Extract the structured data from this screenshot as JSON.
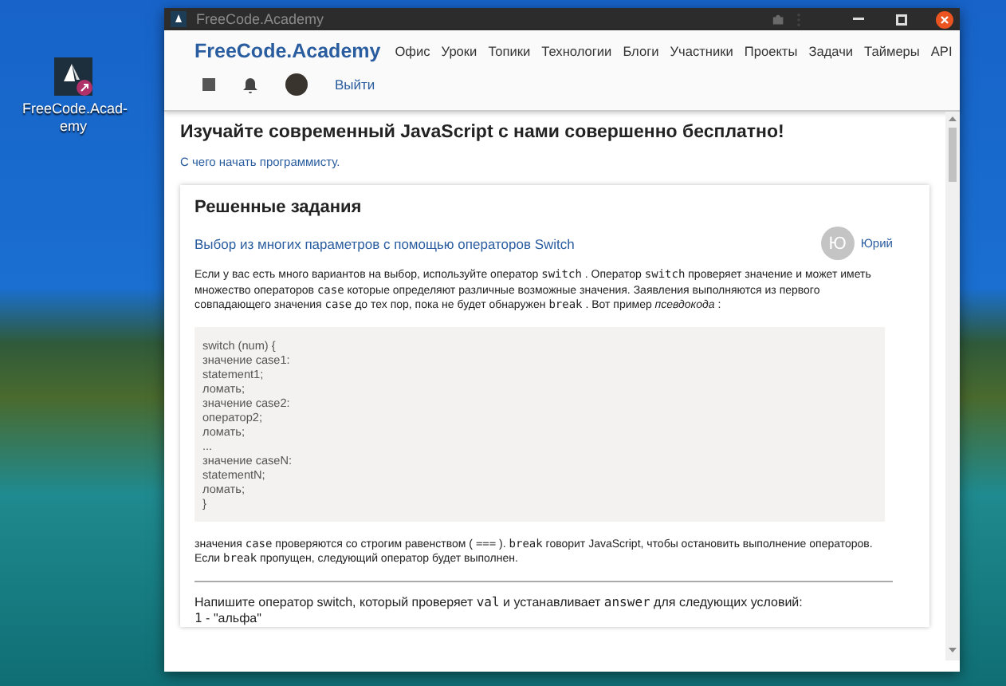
{
  "desktop_icon": {
    "label": "FreeCode.Acad-emy"
  },
  "window": {
    "title": "FreeCode.Academy"
  },
  "nav": {
    "brand": "FreeCode.Academy",
    "items": [
      "Офис",
      "Уроки",
      "Топики",
      "Технологии",
      "Блоги",
      "Участники",
      "Проекты",
      "Задачи",
      "Таймеры",
      "API"
    ],
    "logout": "Выйти"
  },
  "content": {
    "headline": "Изучайте современный JavaScript с нами совершенно бесплатно!",
    "link": "С чего начать программисту.",
    "card": {
      "title": "Решенные задания",
      "task": {
        "title": "Выбор из многих параметров с помощью операторов Switch",
        "author_initial": "Ю",
        "author": "Юрий"
      },
      "intro": [
        {
          "kind": "text",
          "text": "Если у вас есть много вариантов на выбор, используйте оператор "
        },
        {
          "kind": "code",
          "text": "switch"
        },
        {
          "kind": "text",
          "text": " . Оператор "
        },
        {
          "kind": "code",
          "text": "switch"
        },
        {
          "kind": "text",
          "text": " проверяет значение и может иметь множество операторов "
        },
        {
          "kind": "code",
          "text": "case"
        },
        {
          "kind": "text",
          "text": " которые определяют различные возможные значения. Заявления выполняются из первого совпадающего значения "
        },
        {
          "kind": "code",
          "text": "case"
        },
        {
          "kind": "text",
          "text": " до тех пор, пока не будет обнаружен "
        },
        {
          "kind": "code",
          "text": "break"
        },
        {
          "kind": "text",
          "text": " . Вот пример "
        },
        {
          "kind": "em",
          "text": "псевдокода"
        },
        {
          "kind": "text",
          "text": " :"
        }
      ],
      "code_lines": [
        "switch (num) {",
        "значение case1:",
        "statement1;",
        "ломать;",
        "значение case2:",
        "оператор2;",
        "ломать;",
        "...",
        "значение caseN:",
        "statementN;",
        "ломать;",
        "}"
      ],
      "note": [
        {
          "kind": "text",
          "text": "значения "
        },
        {
          "kind": "code",
          "text": "case"
        },
        {
          "kind": "text",
          "text": " проверяются со строгим равенством ( "
        },
        {
          "kind": "code",
          "text": "==="
        },
        {
          "kind": "text",
          "text": " ). "
        },
        {
          "kind": "code",
          "text": "break"
        },
        {
          "kind": "text",
          "text": " говорит JavaScript, чтобы остановить выполнение операторов. Если "
        },
        {
          "kind": "code",
          "text": "break"
        },
        {
          "kind": "text",
          "text": " пропущен, следующий оператор будет выполнен."
        }
      ],
      "question": [
        {
          "kind": "text",
          "text": "Напишите оператор switch, который проверяет "
        },
        {
          "kind": "code",
          "text": "val"
        },
        {
          "kind": "text",
          "text": " и устанавливает "
        },
        {
          "kind": "code",
          "text": "answer"
        },
        {
          "kind": "text",
          "text": " для следующих условий:"
        }
      ],
      "condition": [
        {
          "kind": "code",
          "text": "1"
        },
        {
          "kind": "text",
          "text": " - \"альфа\""
        }
      ]
    }
  }
}
